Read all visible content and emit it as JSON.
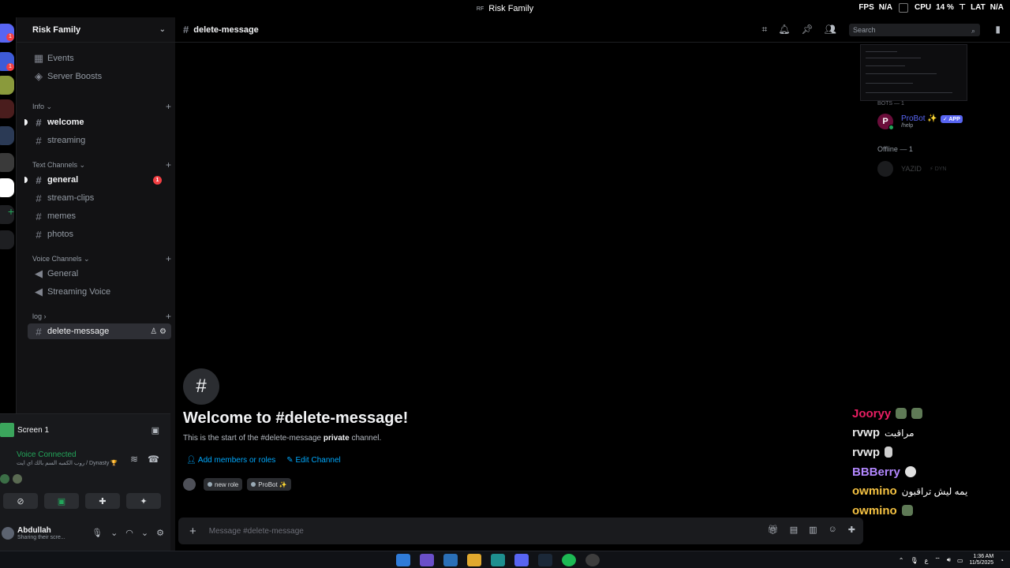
{
  "window": {
    "title": "Risk Family",
    "badge": "RF"
  },
  "overlay": {
    "fps_label": "FPS",
    "fps_value": "N/A",
    "cpu_label": "CPU",
    "cpu_value": "14 %",
    "lat_label": "LAT",
    "lat_value": "N/A"
  },
  "server": {
    "name": "Risk Family"
  },
  "sidebar": {
    "top_items": [
      {
        "label": "Events",
        "icon": "calendar-icon"
      },
      {
        "label": "Server Boosts",
        "icon": "boost-icon"
      }
    ],
    "categories": [
      {
        "label": "Info",
        "channels": [
          {
            "label": "welcome",
            "unread": true
          },
          {
            "label": "streaming",
            "unread": false
          }
        ]
      },
      {
        "label": "Text Channels",
        "channels": [
          {
            "label": "general",
            "unread": true,
            "mentions": "1"
          },
          {
            "label": "stream-clips",
            "unread": false
          },
          {
            "label": "memes",
            "unread": false
          },
          {
            "label": "photos",
            "unread": false
          }
        ]
      },
      {
        "label": "Voice Channels",
        "channels": [
          {
            "label": "General",
            "type": "voice"
          },
          {
            "label": "Streaming Voice",
            "type": "voice"
          }
        ]
      },
      {
        "label": "log",
        "channels": [
          {
            "label": "delete-message",
            "active": true
          }
        ]
      }
    ]
  },
  "voice_panel": {
    "screen_label": "Screen 1",
    "status": "Voice Connected",
    "channel_info": "روب الكمبه السم بالك اي ايت / Dynasty 🏆"
  },
  "user": {
    "name": "Abdullah",
    "status": "Sharing their scre..."
  },
  "chat": {
    "channel": "delete-message",
    "search_placeholder": "Search",
    "welcome_title": "Welcome to #delete-message!",
    "welcome_desc_prefix": "This is the start of the #delete-message ",
    "welcome_desc_bold": "private",
    "welcome_desc_suffix": " channel.",
    "add_members": "Add members or roles",
    "edit_channel": "Edit Channel",
    "roles": [
      "new role",
      "ProBot ✨"
    ],
    "composer_placeholder": "Message #delete-message"
  },
  "members": {
    "bots_label": "BOTS — 1",
    "bot": {
      "name": "ProBot ✨",
      "tag": "✓ APP",
      "sub": "/help",
      "avatar_letter": "P"
    },
    "offline_label": "Offline — 1",
    "offline_member": {
      "name": "YAZID",
      "tag": "⚡ DYN"
    }
  },
  "stream_chat": [
    {
      "user": "Jooryy",
      "color": "#e91e63",
      "msg": ""
    },
    {
      "user": "rvwp",
      "color": "#e6e6e6",
      "msg": "مراقبت"
    },
    {
      "user": "rvwp",
      "color": "#e6e6e6",
      "msg": ""
    },
    {
      "user": "BBBerry",
      "color": "#b388ff",
      "msg": ""
    },
    {
      "user": "owmino",
      "color": "#f5c242",
      "msg": "يمه ليش تراقبون"
    },
    {
      "user": "owmino",
      "color": "#f5c242",
      "msg": ""
    }
  ],
  "taskbar": {
    "time": "1:36 AM",
    "date": "11/5/2025",
    "lang": "ع"
  }
}
